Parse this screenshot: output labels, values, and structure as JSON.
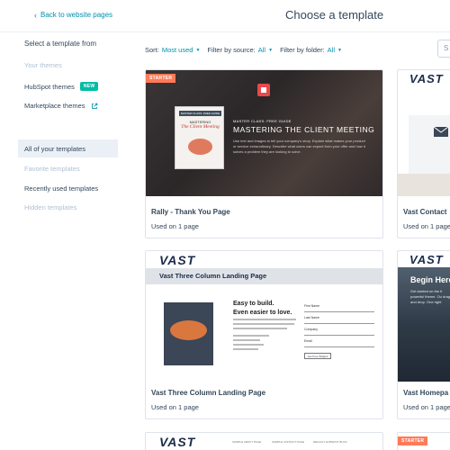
{
  "header": {
    "back_label": "Back to website pages",
    "title": "Choose a template"
  },
  "sidebar": {
    "heading": "Select a template from",
    "sources": [
      {
        "label": "Your themes",
        "disabled": true
      },
      {
        "label": "HubSpot themes",
        "badge": "NEW"
      },
      {
        "label": "Marketplace themes",
        "icon": "external-link-icon"
      }
    ],
    "views": [
      {
        "label": "All of your templates",
        "active": true
      },
      {
        "label": "Favorite templates",
        "disabled": true
      },
      {
        "label": "Recently used templates"
      },
      {
        "label": "Hidden templates",
        "disabled": true
      }
    ]
  },
  "filters": {
    "sort_label": "Sort:",
    "sort_value": "Most used",
    "source_label": "Filter by source:",
    "source_value": "All",
    "folder_label": "Filter by folder:",
    "folder_value": "All",
    "search_placeholder": "S"
  },
  "colors": {
    "accent": "#0091ae",
    "badge_new": "#00bda5",
    "badge_starter": "#ff7a59",
    "text": "#33475b",
    "muted": "#b0c1d4"
  },
  "cards": [
    {
      "title": "Rally - Thank You Page",
      "usage": "Used on 1 page",
      "badge": "STARTER",
      "preview": {
        "book_header": "MASTER CLASS: FREE GUIDE",
        "book_title_1": "MASTERING",
        "book_title_2": "The Client Meeting",
        "kicker": "MASTER CLASS: FREE GUIDE",
        "headline": "MASTERING THE CLIENT MEETING",
        "body": "Use text and images to tell your company's story. Explain what makes your product or service extraordinary. Describe what users can expect from your offer and how it solves a problem they are looking to solve."
      }
    },
    {
      "title": "Vast Contact",
      "usage": "Used on 1 page",
      "preview": {
        "logo": "VAST"
      }
    },
    {
      "title": "Vast Three Column Landing Page",
      "usage": "Used on 1 page",
      "preview": {
        "logo": "VAST",
        "banner": "Vast Three Column Landing Page",
        "h1": "Easy to build.",
        "h2": "Even easier to love.",
        "form_labels": [
          "First Name",
          "Last Name",
          "Company",
          "Email"
        ],
        "form_button": "Get Free Widget!"
      }
    },
    {
      "title": "Vast Homepa",
      "usage": "Used on 1 page",
      "preview": {
        "logo": "VAST",
        "hero_title": "Begin Here",
        "hero_body": "Get started on the fr powerful theme. Ou drag and drop. One right"
      }
    },
    {
      "title": "",
      "badge": "STARTER",
      "preview": {
        "logo": "VAST",
        "nav": [
          "SAMPLE ABOUT PAGE",
          "SAMPLE CONTACT PAGE",
          "DEFAULT HUBSPOT BLOG"
        ]
      }
    }
  ]
}
